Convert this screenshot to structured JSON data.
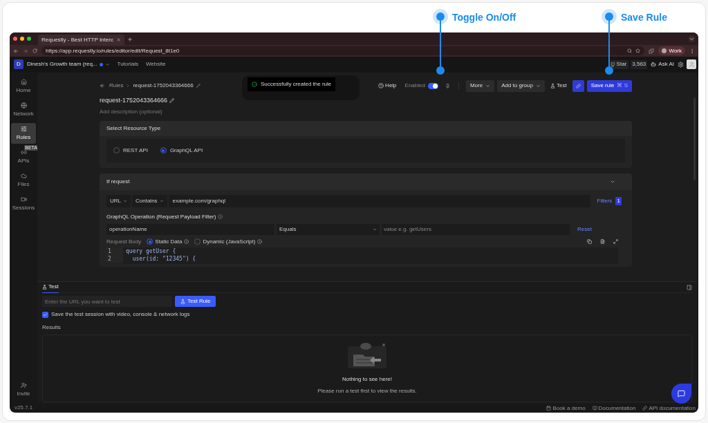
{
  "annotations": [
    {
      "label": "Toggle On/Off"
    },
    {
      "label": "Save Rule"
    }
  ],
  "browser": {
    "tab_title": "Requestly - Best HTTP Interc",
    "url": "https://app.requestly.io/rules/editor/edit/Request_8t1e0",
    "profile": "Work"
  },
  "header": {
    "avatar_letter": "D",
    "workspace": "Dinesh's Growth team (req...",
    "links": [
      "Tutorials",
      "Website"
    ],
    "github_star": "Star",
    "star_count": "3,563",
    "ask_ai": "Ask AI"
  },
  "sidebar": {
    "items": [
      {
        "kind": "home",
        "label": "Home",
        "selected": false
      },
      {
        "kind": "network",
        "label": "Network",
        "selected": false
      },
      {
        "kind": "rules",
        "label": "Rules",
        "selected": true
      },
      {
        "kind": "apis",
        "label": "APIs",
        "selected": false,
        "badge": "BETA"
      },
      {
        "kind": "files",
        "label": "Files",
        "selected": false
      },
      {
        "kind": "sessions",
        "label": "Sessions",
        "selected": false
      }
    ],
    "invite": "Invite",
    "version": "v25.7.1"
  },
  "toolbar": {
    "breadcrumb_root": "Rules",
    "breadcrumb_current": "request-1752043364666",
    "toast": "Successfully created the rule",
    "help": "Help",
    "enabled_label": "Enabled",
    "enabled": true,
    "more": "More",
    "add_to_group": "Add to group",
    "test": "Test",
    "save": "Save rule",
    "save_shortcut": "⌘ S"
  },
  "rule": {
    "name": "request-1752043364666",
    "description_placeholder": "Add description (optional)"
  },
  "resource_type": {
    "title": "Select Resource Type",
    "options": [
      {
        "label": "REST API",
        "selected": false
      },
      {
        "label": "GraphQL API",
        "selected": true
      }
    ]
  },
  "condition": {
    "title": "If request",
    "source": "URL",
    "operator": "Contains",
    "value": "example.com/graphql",
    "filters": "Filters",
    "filter_count": "1",
    "graphql_title": "GraphQL Operation (Request Payload Filter)",
    "operation_key": "operationName",
    "operation_operator": "Equals",
    "operation_value_placeholder": "value e.g. getUsers",
    "reset": "Reset",
    "body_label": "Request Body",
    "body_modes": [
      {
        "label": "Static Data",
        "selected": true
      },
      {
        "label": "Dynamic (JavaScript)",
        "selected": false
      }
    ],
    "code_lines": [
      {
        "number": "1",
        "text": "query getUser {"
      },
      {
        "number": "2",
        "text": "  user(id: \"12345\") {"
      }
    ]
  },
  "test_panel": {
    "tab": "Test",
    "url_placeholder": "Enter the URL you want to test",
    "button": "Test Rule",
    "save_session": {
      "label": "Save the test session with video, console & network logs",
      "checked": true
    },
    "results_title": "Results",
    "empty_title": "Nothing to see here!",
    "empty_text": "Please run a test first to view the results."
  },
  "footer_links": [
    {
      "kind": "calendar",
      "label": "Book a demo"
    },
    {
      "kind": "book",
      "label": "Documentation"
    },
    {
      "kind": "link",
      "label": "API documentation"
    }
  ]
}
